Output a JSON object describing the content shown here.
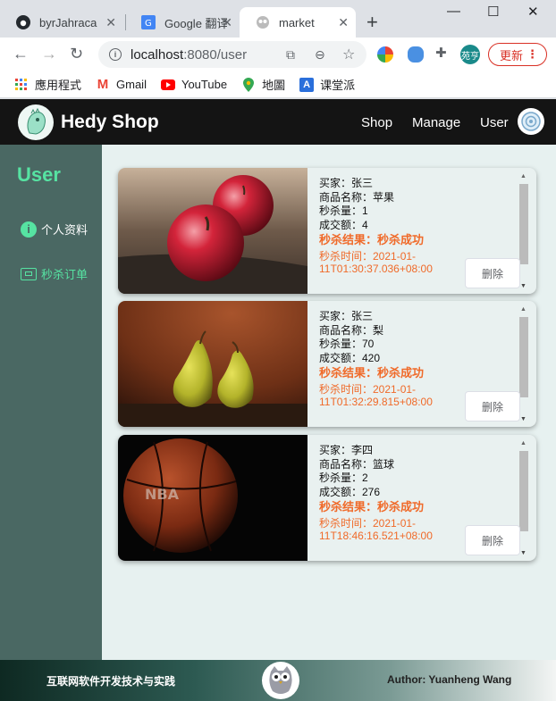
{
  "browser": {
    "tabs": [
      {
        "label": "byrJahraca",
        "icon": "github-icon"
      },
      {
        "label": "Google 翻译",
        "icon": "google-translate-icon"
      },
      {
        "label": "market",
        "icon": "owl-icon",
        "active": true
      }
    ],
    "url": {
      "host": "localhost",
      "rest": ":8080/user"
    },
    "profile_badge": "苑亨",
    "update_label": "更新",
    "bookmarks": [
      {
        "label": "應用程式",
        "icon": "apps-grid-icon"
      },
      {
        "label": "Gmail",
        "icon": "gmail-icon"
      },
      {
        "label": "YouTube",
        "icon": "youtube-icon"
      },
      {
        "label": "地圖",
        "icon": "maps-icon"
      },
      {
        "label": "课堂派",
        "icon": "ketangpai-icon"
      }
    ]
  },
  "app": {
    "brand": "Hedy Shop",
    "nav": [
      "Shop",
      "Manage",
      "User"
    ],
    "sidebar": {
      "title": "User",
      "items": [
        {
          "label": "个人资料",
          "icon": "info-icon"
        },
        {
          "label": "秒杀订单",
          "icon": "order-icon",
          "selected": true
        }
      ]
    },
    "orders": [
      {
        "buyer": "买家：张三",
        "product": "商品名称：苹果",
        "qty": "秒杀量：1",
        "amount": "成交额：4",
        "result": "秒杀结果：秒杀成功",
        "time_line1": "秒杀时间：2021-01-",
        "time_line2": "11T01:30:37.036+08:00",
        "delete": "删除",
        "image": "apple-photo"
      },
      {
        "buyer": "买家：张三",
        "product": "商品名称：梨",
        "qty": "秒杀量：70",
        "amount": "成交额：420",
        "result": "秒杀结果：秒杀成功",
        "time_line1": "秒杀时间：2021-01-",
        "time_line2": "11T01:32:29.815+08:00",
        "delete": "删除",
        "image": "pear-photo"
      },
      {
        "buyer": "买家：李四",
        "product": "商品名称：篮球",
        "qty": "秒杀量：2",
        "amount": "成交额：276",
        "result": "秒杀结果：秒杀成功",
        "time_line1": "秒杀时间：2021-01-",
        "time_line2": "11T18:46:16.521+08:00",
        "delete": "删除",
        "image": "basketball-photo"
      }
    ],
    "footer": {
      "left": "互联网软件开发技术与实践",
      "right": "Author: Yuanheng Wang"
    }
  },
  "colors": {
    "accent": "#56e3a2",
    "result": "#f06a29",
    "sidebar": "#4a6863",
    "appbar": "#141414"
  }
}
